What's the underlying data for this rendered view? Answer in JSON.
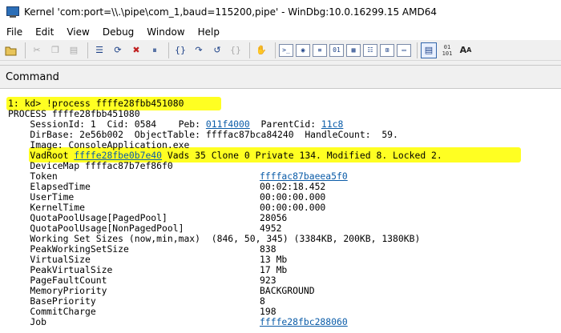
{
  "window": {
    "title": "Kernel 'com:port=\\\\.\\pipe\\com_1,baud=115200,pipe' - WinDbg:10.0.16299.15 AMD64"
  },
  "menu": [
    "File",
    "Edit",
    "View",
    "Debug",
    "Window",
    "Help"
  ],
  "toolbar": {
    "icons": [
      "open-folder-icon",
      "cut-icon",
      "copy-icon",
      "paste-icon",
      "step-list-icon",
      "restart-icon",
      "stop-debugging-icon",
      "break-icon",
      "go-icon",
      "step-into-icon",
      "step-over-icon",
      "step-out-icon",
      "run-to-cursor-icon",
      "hand-icon",
      "command-window-icon",
      "watch-window-icon",
      "locals-window-icon",
      "registers-window-icon",
      "memory-window-icon",
      "call-stack-icon",
      "disassembly-window-icon",
      "scratch-pad-icon",
      "source-mode-icon",
      "hex-display-icon",
      "font-icon",
      "options-icon"
    ],
    "labels": {
      "hex": "01\n10",
      "font": "A",
      "font_small": "A"
    }
  },
  "command_window": {
    "title": "Command",
    "prompt": "1: kd> !process ffffe28fbb451080",
    "process_line": "PROCESS ffffe28fbb451080",
    "session": {
      "prefix": "    SessionId: 1  Cid: 0584    Peb: ",
      "peb": "011f4000",
      "mid": "  ParentCid: ",
      "parent_cid": "11c8"
    },
    "dirbase_line": "    DirBase: 2e56b002  ObjectTable: ffffac87bca84240  HandleCount:  59.",
    "image_line": "    Image: ConsoleApplication.exe",
    "vadroot": {
      "label": "    VadRoot ",
      "address": "ffffe28fbe0b7e40",
      "rest": " Vads 35 Clone 0 Private 134. Modified 8. Locked 2."
    },
    "devicemap_line": "    DeviceMap ffffac87b7ef86f0",
    "fields": [
      {
        "name": "    Token",
        "value": "ffffac87baeea5f0",
        "link": true
      },
      {
        "name": "    ElapsedTime",
        "value": "00:02:18.452",
        "link": false
      },
      {
        "name": "    UserTime",
        "value": "00:00:00.000",
        "link": false
      },
      {
        "name": "    KernelTime",
        "value": "00:00:00.000",
        "link": false
      },
      {
        "name": "    QuotaPoolUsage[PagedPool]",
        "value": "28056",
        "link": false
      },
      {
        "name": "    QuotaPoolUsage[NonPagedPool]",
        "value": "4952",
        "link": false
      },
      {
        "name": "    Working Set Sizes (now,min,max)  (846, 50, 345) (3384KB, 200KB, 1380KB)",
        "value": "",
        "link": false
      },
      {
        "name": "    PeakWorkingSetSize",
        "value": "838",
        "link": false
      },
      {
        "name": "    VirtualSize",
        "value": "13 Mb",
        "link": false
      },
      {
        "name": "    PeakVirtualSize",
        "value": "17 Mb",
        "link": false
      },
      {
        "name": "    PageFaultCount",
        "value": "923",
        "link": false
      },
      {
        "name": "    MemoryPriority",
        "value": "BACKGROUND",
        "link": false
      },
      {
        "name": "    BasePriority",
        "value": "8",
        "link": false
      },
      {
        "name": "    CommitCharge",
        "value": "198",
        "link": false
      },
      {
        "name": "    Job",
        "value": "ffffe28fbc288060",
        "link": true
      }
    ]
  },
  "colors": {
    "highlight": "#ffff22",
    "link": "#0b5ca8"
  }
}
